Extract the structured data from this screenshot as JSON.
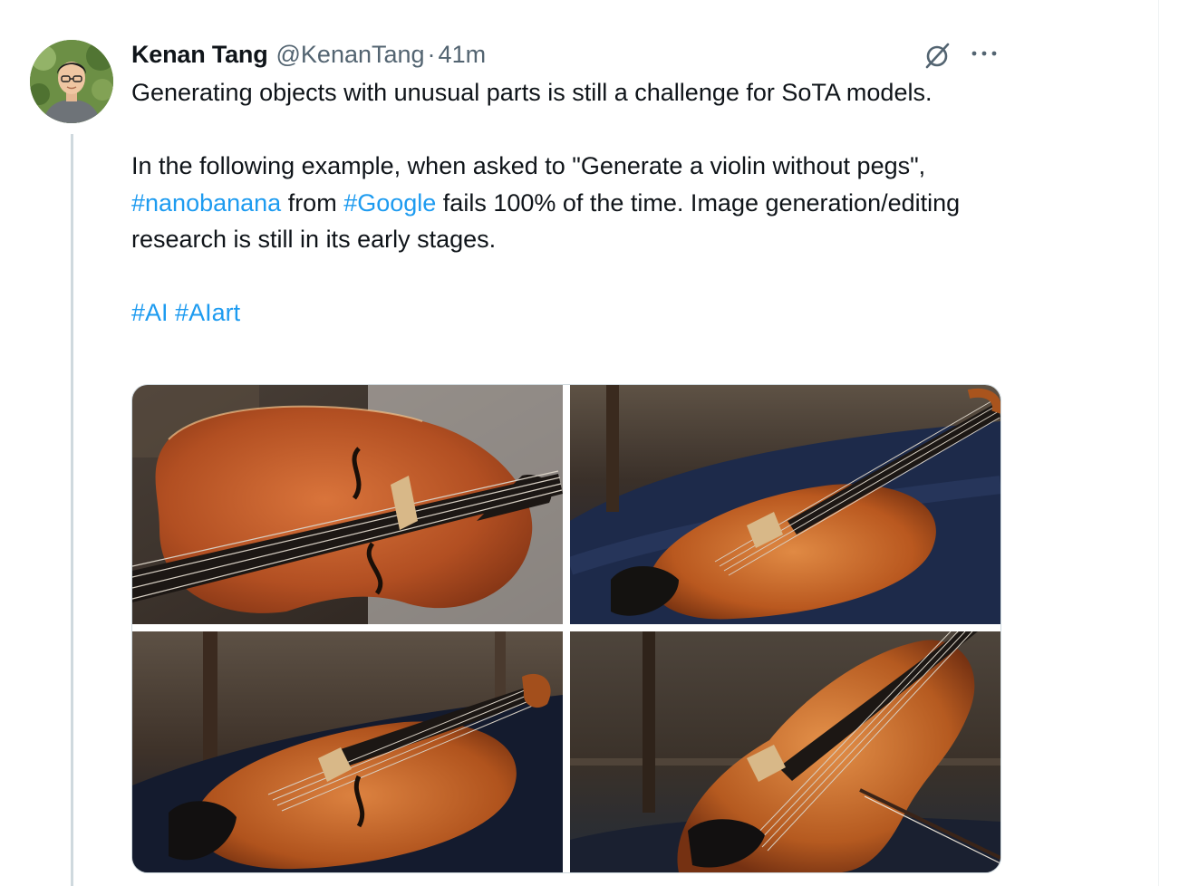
{
  "tweet": {
    "author": {
      "display_name": "Kenan Tang",
      "handle": "@KenanTang",
      "separator": "·",
      "time": "41m"
    },
    "actions": {
      "grok_icon": "grok-icon",
      "more_icon": "more-icon"
    },
    "text": {
      "line1": "Generating objects with unusual parts is still a challenge for SoTA models.",
      "line2_a": "In the following example, when asked to \"Generate a violin without pegs\", ",
      "tag_nanobanana": "#nanobanana",
      "line2_b": " from ",
      "tag_google": "#Google",
      "line2_c": " fails 100% of the time. Image generation/editing research is still in its early stages.",
      "tag_ai": "#AI",
      "tag_aiart": "#AIart"
    },
    "media": {
      "count": 4,
      "images": [
        "violin-photo-1",
        "violin-photo-2",
        "violin-photo-3",
        "violin-photo-4"
      ]
    }
  },
  "colors": {
    "link": "#1d9bf0",
    "text": "#0f1419",
    "muted": "#536471",
    "thread_line": "#cfd9de"
  }
}
